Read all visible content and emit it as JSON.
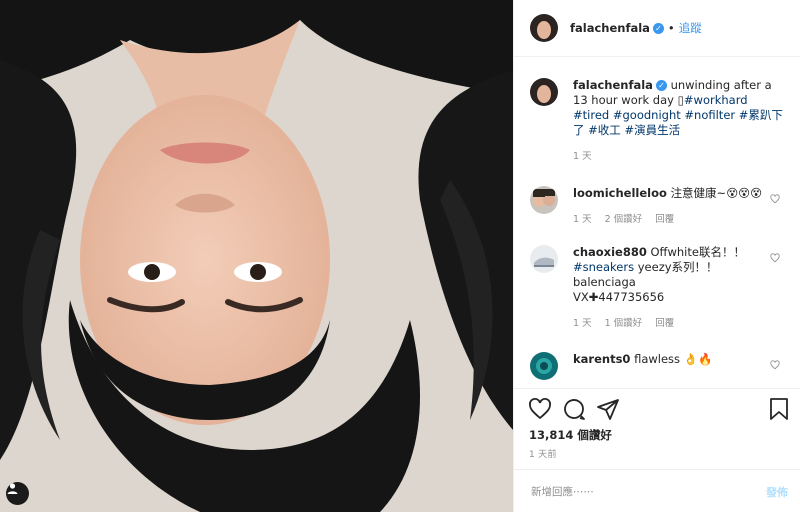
{
  "post": {
    "username": "falachenfala",
    "follow_label": "追蹤",
    "caption": {
      "username": "falachenfala",
      "text": "unwinding after a 13 hour work day ",
      "hashtags": [
        "#workhard",
        "#tired",
        "#goodnight",
        "#nofilter",
        "#累趴下了",
        "#收工",
        "#演員生活"
      ],
      "time": "1 天"
    },
    "comments": [
      {
        "username": "loomichelleloo",
        "text": "注意健康~😵😵😵",
        "time": "1 天",
        "likes": "2 個讚好",
        "reply": "回覆"
      },
      {
        "username": "chaoxie880",
        "text": "Offwhite联名！！",
        "hashtag": "#sneakers",
        "text2": " yeezy系列！！",
        "line3": "balenciaga",
        "line4": "VX✚447735656",
        "time": "1 天",
        "likes": "1 個讚好",
        "reply": "回覆"
      },
      {
        "username": "karents0",
        "text": "flawless 👌🔥"
      }
    ],
    "likes": "13,814 個讚好",
    "date": "1 天前",
    "add_comment_placeholder": "新增回應⋯⋯",
    "post_button": "發佈"
  },
  "icons": [
    "verified-badge-icon",
    "heart-icon",
    "comment-icon",
    "share-icon",
    "bookmark-icon",
    "tag-user-icon"
  ],
  "colors": {
    "link": "#3897f0",
    "hashtag": "#00376b",
    "muted": "#8e8e8e",
    "post_disabled": "#b2dffc"
  }
}
